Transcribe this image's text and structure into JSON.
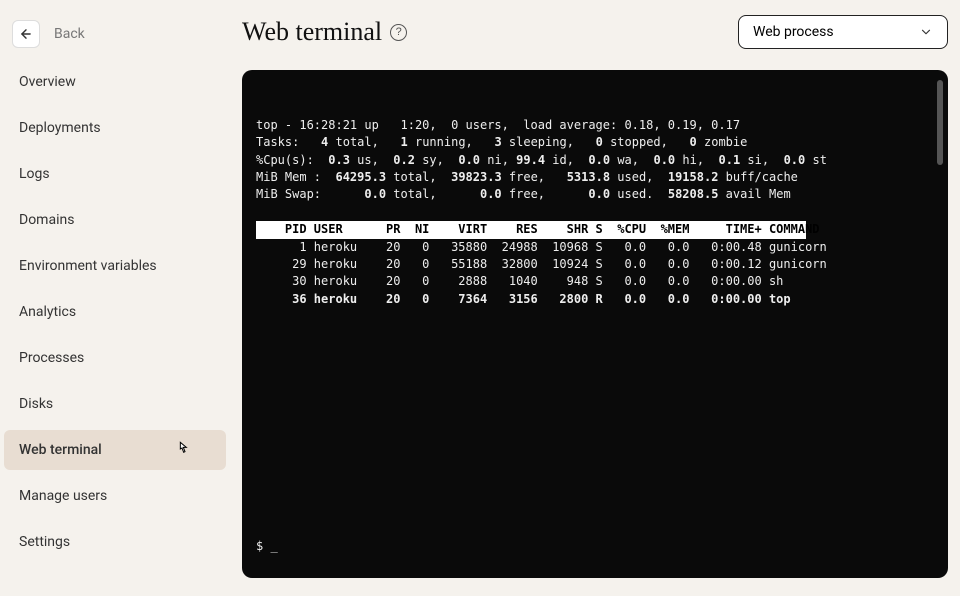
{
  "header": {
    "back_label": "Back"
  },
  "sidebar": {
    "items": [
      {
        "label": "Overview"
      },
      {
        "label": "Deployments"
      },
      {
        "label": "Logs"
      },
      {
        "label": "Domains"
      },
      {
        "label": "Environment variables"
      },
      {
        "label": "Analytics"
      },
      {
        "label": "Processes"
      },
      {
        "label": "Disks"
      },
      {
        "label": "Web terminal"
      },
      {
        "label": "Manage users"
      },
      {
        "label": "Settings"
      }
    ],
    "active_index": 8
  },
  "main": {
    "title": "Web terminal",
    "process_select": "Web process"
  },
  "terminal": {
    "summary": {
      "line1": "top - 16:28:21 up   1:20,  0 users,  load average: 0.18, 0.19, 0.17",
      "line2": "Tasks:   4 total,   1 running,   3 sleeping,   0 stopped,   0 zombie",
      "line3": "%Cpu(s):  0.3 us,  0.2 sy,  0.0 ni, 99.4 id,  0.0 wa,  0.0 hi,  0.1 si,  0.0 st",
      "line4": "MiB Mem :  64295.3 total,  39823.3 free,   5313.8 used,  19158.2 buff/cache",
      "line5": "MiB Swap:      0.0 total,      0.0 free,      0.0 used.  58208.5 avail Mem"
    },
    "columns_header": "    PID USER      PR  NI    VIRT    RES    SHR S  %CPU  %MEM     TIME+ COMMAND",
    "processes": [
      "      1 heroku    20   0   35880  24988  10968 S   0.0   0.0   0:00.48 gunicorn",
      "     29 heroku    20   0   55188  32800  10924 S   0.0   0.0   0:00.12 gunicorn",
      "     30 heroku    20   0    2888   1040    948 S   0.0   0.0   0:00.00 sh",
      "     36 heroku    20   0    7364   3156   2800 R   0.0   0.0   0:00.00 top"
    ],
    "prompt": "$ _"
  }
}
